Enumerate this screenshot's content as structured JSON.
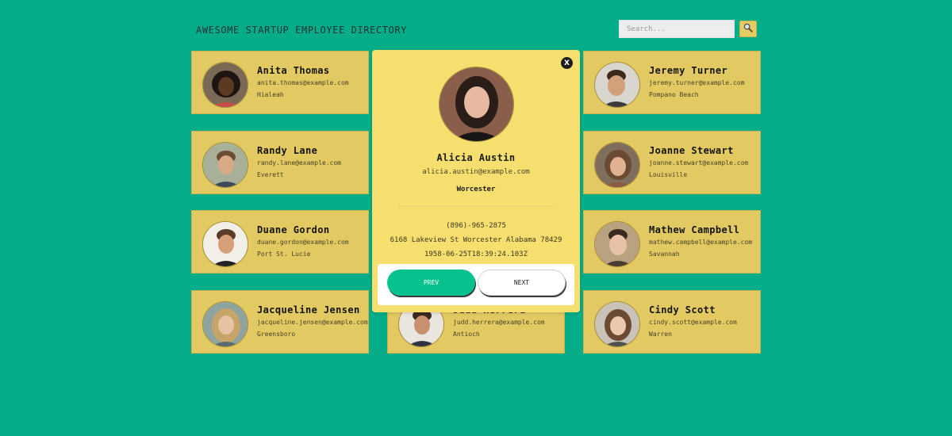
{
  "header": {
    "title": "AWESOME STARTUP EMPLOYEE DIRECTORY",
    "search_placeholder": "Search...",
    "search_icon": "magnifier-icon"
  },
  "colors": {
    "background": "#05ad88",
    "card": "#e2c962",
    "modal": "#f6df6e",
    "prev_button": "#05c28f"
  },
  "employees": [
    {
      "name": "Anita Thomas",
      "email": "anita.thomas@example.com",
      "city": "Hialeah"
    },
    {
      "name": "Jeremy Turner",
      "email": "jeremy.turner@example.com",
      "city": "Pompano Beach"
    },
    {
      "name": "Randy Lane",
      "email": "randy.lane@example.com",
      "city": "Everett"
    },
    {
      "name": "Joanne Stewart",
      "email": "joanne.stewart@example.com",
      "city": "Louisville"
    },
    {
      "name": "Duane Gordon",
      "email": "duane.gordon@example.com",
      "city": "Port St. Lucie"
    },
    {
      "name": "Mathew Campbell",
      "email": "mathew.campbell@example.com",
      "city": "Savannah"
    },
    {
      "name": "Jacqueline Jensen",
      "email": "jacqueline.jensen@example.com",
      "city": "Greensboro"
    },
    {
      "name": "Judd Herrera",
      "email": "judd.herrera@example.com",
      "city": "Antioch"
    },
    {
      "name": "Cindy Scott",
      "email": "cindy.scott@example.com",
      "city": "Warren"
    }
  ],
  "modal": {
    "close_label": "X",
    "name": "Alicia Austin",
    "email": "alicia.austin@example.com",
    "city": "Worcester",
    "phone": "(896)-965-2875",
    "address": "6168 Lakeview St Worcester Alabama 78429",
    "birthday": "1958-06-25T18:39:24.103Z",
    "prev_label": "PREV",
    "next_label": "NEXT"
  }
}
